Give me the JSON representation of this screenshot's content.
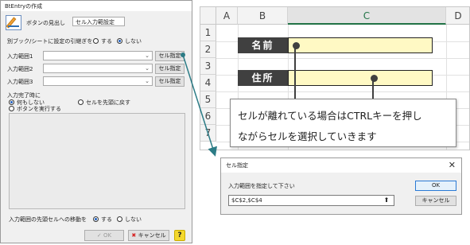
{
  "dialog": {
    "title": "BtEntryの作成",
    "caption_label": "ボタンの見出し",
    "caption_value": "セル入力範設定",
    "other_sheet_label": "別ブック/シートに設定の引継ぎを",
    "other_sheet_yes": "する",
    "other_sheet_no": "しない",
    "ranges": [
      {
        "label": "入力範囲1",
        "button": "セル指定"
      },
      {
        "label": "入力範囲2",
        "button": "セル指定"
      },
      {
        "label": "入力範囲3",
        "button": "セル指定"
      }
    ],
    "on_complete_label": "入力完了時に",
    "on_complete_options": [
      "何もしない",
      "セルを先頭に戻す",
      "ボタンを実行する"
    ],
    "move_first_label": "入力範囲の先頭セルへの移動を",
    "move_first_yes": "する",
    "move_first_no": "しない",
    "ok_label": "OK",
    "cancel_label": "キャンセル",
    "help_label": "?"
  },
  "sheet": {
    "columns": [
      "A",
      "B",
      "C",
      "D"
    ],
    "rows": [
      "1",
      "2",
      "3",
      "4",
      "5",
      "6",
      "7"
    ],
    "field1_label": "名前",
    "field2_label": "住所",
    "input_fill": "#fff9c4",
    "label_fill": "#404040"
  },
  "callout": {
    "line1": "セルが離れている場合はCTRLキーを押し",
    "line2": "ながらセルを選択していきます"
  },
  "cell_dialog": {
    "title": "セル指定",
    "close_symbol": "✕",
    "prompt": "入力範囲を指定して下さい",
    "ref_value": "$C$2,$C$4",
    "collapse_symbol": "⬆",
    "ok_label": "OK",
    "cancel_label": "キャンセル"
  }
}
